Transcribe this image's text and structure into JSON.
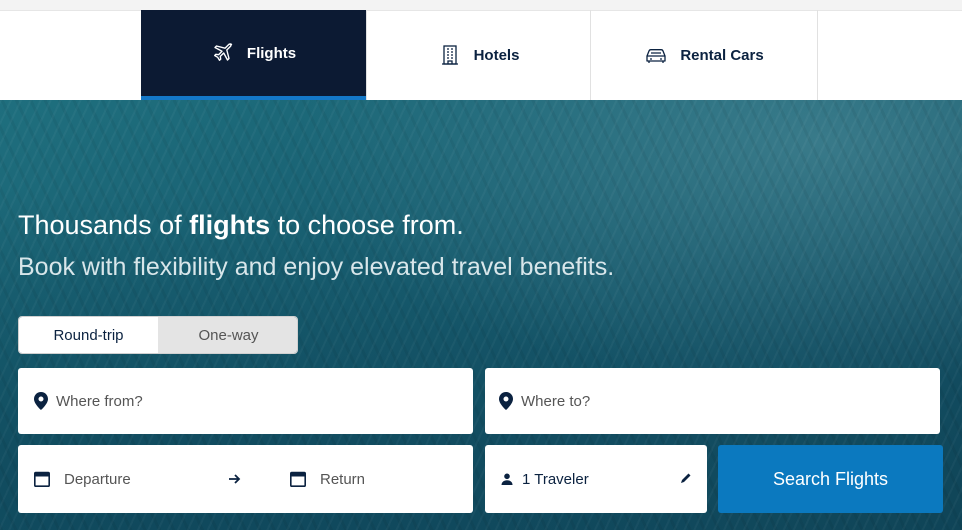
{
  "tabs": [
    {
      "label": "Flights",
      "icon": "airplane-icon",
      "active": true
    },
    {
      "label": "Hotels",
      "icon": "hotel-building-icon",
      "active": false
    },
    {
      "label": "Rental Cars",
      "icon": "car-icon",
      "active": false
    }
  ],
  "hero": {
    "headline_pre": "Thousands of ",
    "headline_bold": "flights",
    "headline_post": " to choose from.",
    "subheadline": "Book with flexibility and enjoy elevated travel benefits."
  },
  "trip_type": {
    "options": [
      "Round-trip",
      "One-way"
    ],
    "selected": "Round-trip"
  },
  "form": {
    "from_placeholder": "Where from?",
    "to_placeholder": "Where to?",
    "departure_placeholder": "Departure",
    "return_placeholder": "Return",
    "travelers": "1 Traveler",
    "search_label": "Search Flights"
  },
  "colors": {
    "active_tab_bg": "#0c1a33",
    "accent_blue": "#0b79bf",
    "text_navy": "#0b2240"
  }
}
